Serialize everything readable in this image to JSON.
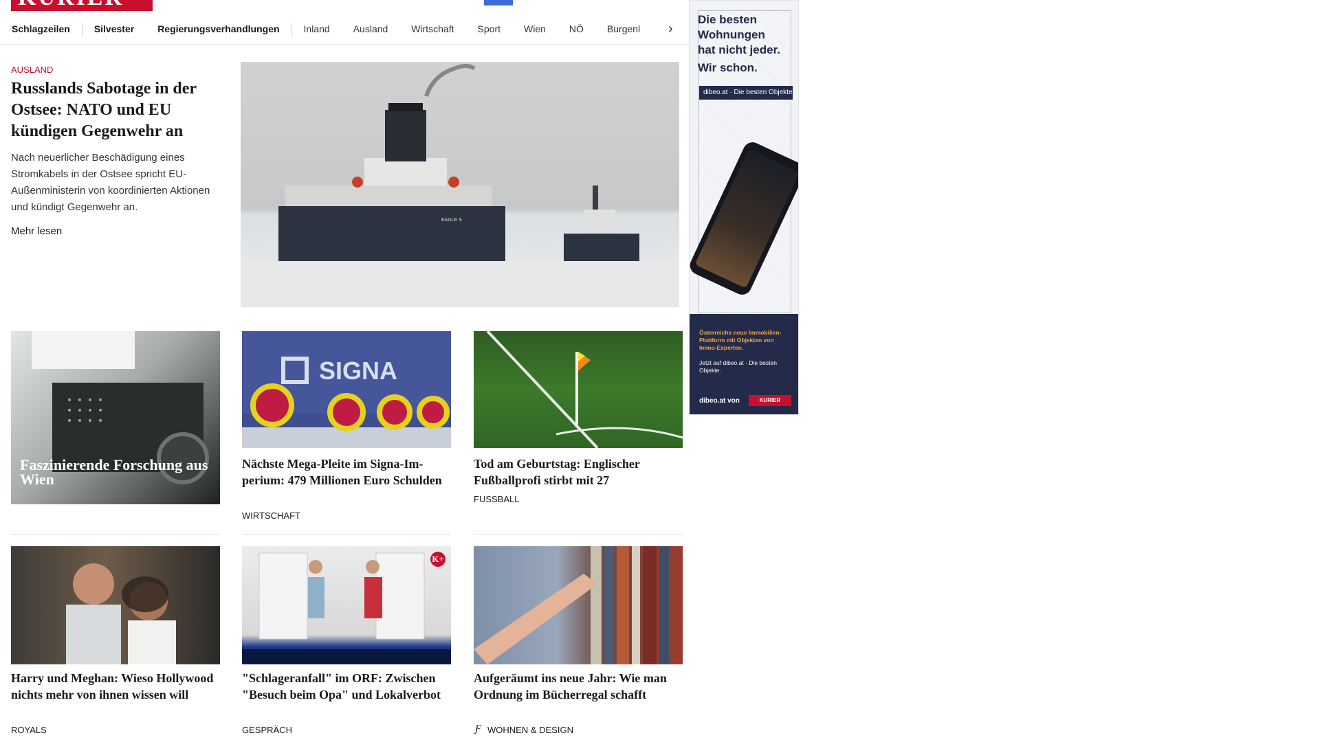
{
  "brand": {
    "logo": "KURIER",
    "accent": "#c8102e"
  },
  "nav": {
    "items": [
      {
        "label": "Schlagzeilen"
      },
      {
        "label": "Silvester"
      },
      {
        "label": "Regierungsverhandlungen"
      },
      {
        "label": "Inland"
      },
      {
        "label": "Ausland"
      },
      {
        "label": "Wirtschaft"
      },
      {
        "label": "Sport"
      },
      {
        "label": "Wien"
      },
      {
        "label": "NÖ"
      },
      {
        "label": "Burgenl"
      }
    ],
    "scroll_icon": "chevron-right-icon"
  },
  "hero": {
    "kicker": "AUSLAND",
    "title": "Russlands Sabotage in der Ostsee: NATO und EU kündigen Gegenwehr an",
    "teaser": "Nach neuerlicher Beschädigung eines Stromkabels in der Ostsee spricht EU-Außenministerin von koordinierten Aktionen und kündigt Gegenwehr an.",
    "more": "Mehr lesen",
    "ship_name": "EAGLE S"
  },
  "cards": [
    {
      "overlay_title": "Faszinierende Forschung aus Wien"
    },
    {
      "title": "Nächste Mega-Pleite im Signa-Im­perium: 479 Millionen Euro Schulden",
      "category": "WIRTSCHAFT",
      "image_text": "SIGNA"
    },
    {
      "title": "Tod am Geburtstag: Englischer Fußballprofi stirbt mit 27",
      "category": "FUSSBALL"
    },
    {
      "title": "Harry und Meghan: Wieso Holly­wood nichts mehr von ihnen wis­sen will",
      "category": "ROYALS"
    },
    {
      "title": "\"Schlageranfall\" im ORF: Zwischen \"Besuch beim Opa\" und Lokalverbot",
      "category": "GESPRÄCH",
      "badge": "K+"
    },
    {
      "title": "Aufgeräumt ins neue Jahr: Wie man Ordnung im Bücherregal schafft",
      "category": "WOHNEN & DESIGN",
      "icon": "script-f-icon"
    }
  ],
  "ad": {
    "headline": "Die besten Wohnungen hat nicht jeder.",
    "headline2": "Wir schon.",
    "brand_bar": "dibeo.at · Die besten Objekte",
    "footer_text1": "Österreichs neue Immobilien-Plattform mit Objekten von Immo-Experten.",
    "footer_text2": "Jetzt auf dibeo.at - Die besten Objekte.",
    "footer_brand": "dibeo.at von",
    "footer_logo": "KURIER"
  }
}
